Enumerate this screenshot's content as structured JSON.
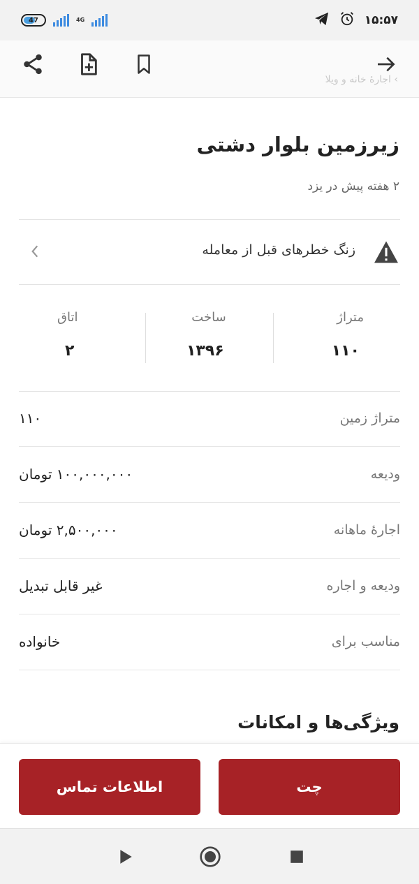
{
  "status_bar": {
    "battery_level": "47",
    "network_type": "4G",
    "clock": "۱۵:۵۷"
  },
  "toolbar": {
    "breadcrumb": "› اجارهٔ خانه و ویلا",
    "icons": [
      "arrow-right-icon",
      "bookmark-icon",
      "add-note-icon",
      "share-icon"
    ]
  },
  "listing": {
    "title": "زیرزمین بلوار دشتی",
    "subtitle": "۲ هفته پیش در یزد"
  },
  "warning": {
    "text": "زنگ خطرهای قبل از معامله"
  },
  "stats": [
    {
      "label": "متراژ",
      "value": "۱۱۰"
    },
    {
      "label": "ساخت",
      "value": "۱۳۹۶"
    },
    {
      "label": "اتاق",
      "value": "۲"
    }
  ],
  "details": [
    {
      "label": "متراژ زمین",
      "value": "۱۱۰"
    },
    {
      "label": "ودیعه",
      "value": "۱۰۰,۰۰۰,۰۰۰ تومان"
    },
    {
      "label": "اجارهٔ ماهانه",
      "value": "۲,۵۰۰,۰۰۰ تومان"
    },
    {
      "label": "ودیعه و اجاره",
      "value": "غیر قابل تبدیل"
    },
    {
      "label": "مناسب برای",
      "value": "خانواده"
    }
  ],
  "features_title": "ویژگی‌ها و امکانات",
  "actions": {
    "chat_label": "چت",
    "contact_label": "اطلاعات تماس"
  },
  "colors": {
    "accent": "#a72226",
    "signal": "#3d8be0"
  }
}
